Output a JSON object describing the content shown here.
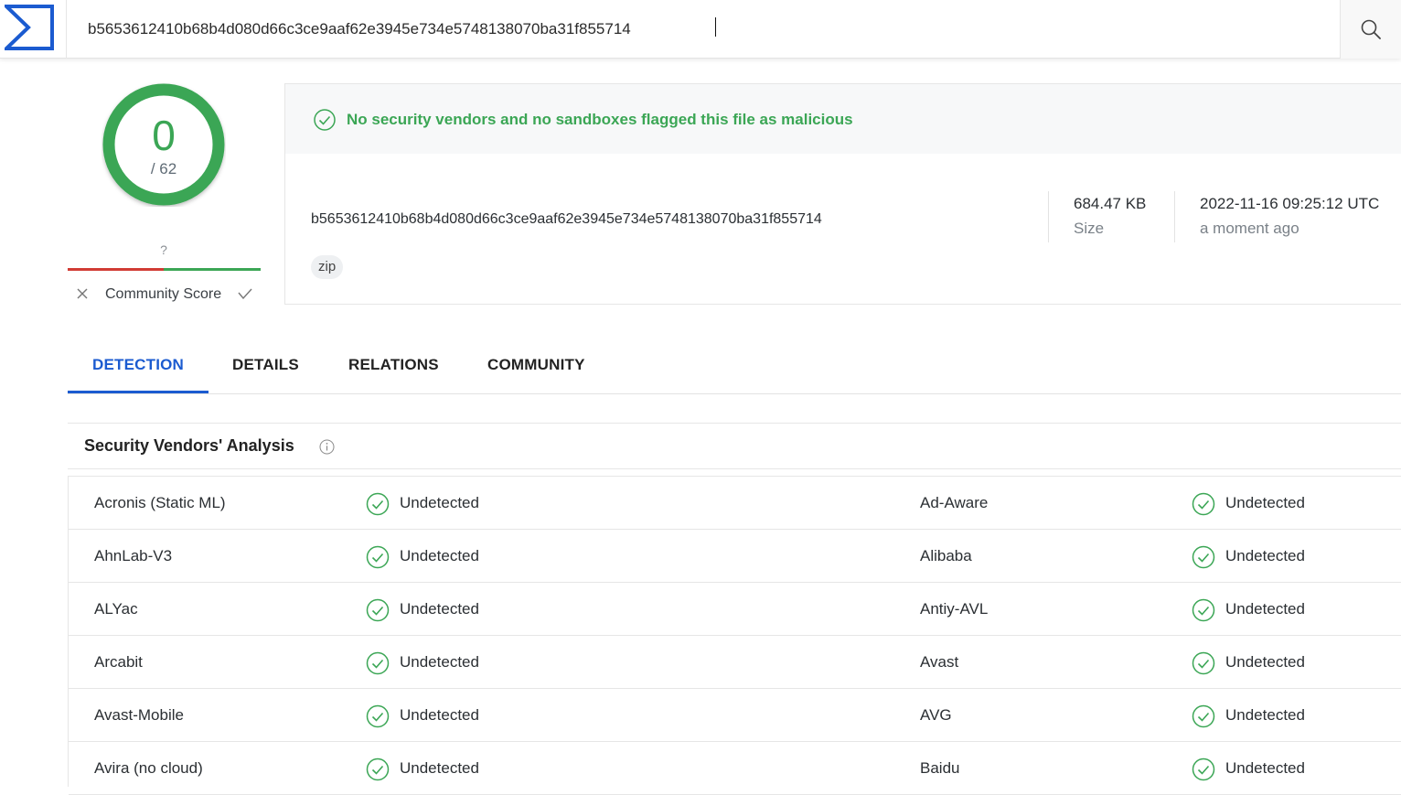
{
  "search": {
    "query": "b5653612410b68b4d080d66c3ce9aaf62e3945e734e5748138070ba31f855714"
  },
  "score": {
    "detections": "0",
    "total": "/ 62",
    "community_unknown": "?",
    "community_label": "Community Score"
  },
  "file": {
    "verdict": "No security vendors and no sandboxes flagged this file as malicious",
    "hash": "b5653612410b68b4d080d66c3ce9aaf62e3945e734e5748138070ba31f855714",
    "tag": "zip",
    "size_value": "684.47 KB",
    "size_label": "Size",
    "date_value": "2022-11-16 09:25:12 UTC",
    "date_relative": "a moment ago"
  },
  "tabs": [
    "DETECTION",
    "DETAILS",
    "RELATIONS",
    "COMMUNITY"
  ],
  "vendors_panel": {
    "title": "Security Vendors' Analysis",
    "rows": [
      {
        "left": "Acronis (Static ML)",
        "left_result": "Undetected",
        "right": "Ad-Aware",
        "right_result": "Undetected"
      },
      {
        "left": "AhnLab-V3",
        "left_result": "Undetected",
        "right": "Alibaba",
        "right_result": "Undetected"
      },
      {
        "left": "ALYac",
        "left_result": "Undetected",
        "right": "Antiy-AVL",
        "right_result": "Undetected"
      },
      {
        "left": "Arcabit",
        "left_result": "Undetected",
        "right": "Avast",
        "right_result": "Undetected"
      },
      {
        "left": "Avast-Mobile",
        "left_result": "Undetected",
        "right": "AVG",
        "right_result": "Undetected"
      },
      {
        "left": "Avira (no cloud)",
        "left_result": "Undetected",
        "right": "Baidu",
        "right_result": "Undetected"
      }
    ]
  },
  "colors": {
    "accent_blue": "#1b5bd0",
    "clean_green": "#3ba655",
    "malicious_red": "#d13b34"
  },
  "icons": {
    "logo": "virustotal-sigma-logo",
    "search": "search-icon",
    "clean": "check-circle-icon",
    "info": "info-icon"
  }
}
